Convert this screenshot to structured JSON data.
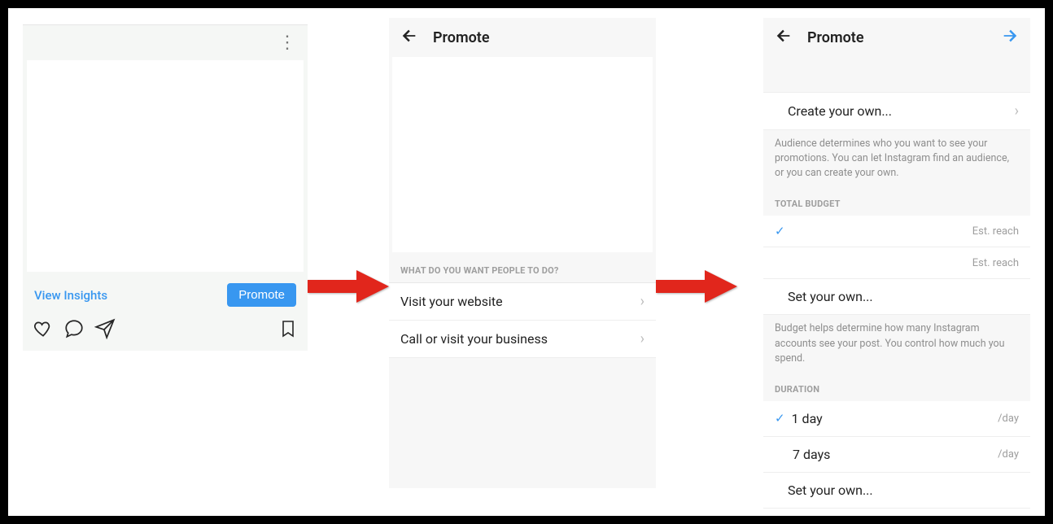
{
  "panel1": {
    "insights_label": "View Insights",
    "promote_label": "Promote"
  },
  "panel2": {
    "title": "Promote",
    "section_label": "WHAT DO YOU WANT PEOPLE TO DO?",
    "options": [
      {
        "label": "Visit your website"
      },
      {
        "label": "Call or visit your business"
      }
    ]
  },
  "panel3": {
    "title": "Promote",
    "create_own_label": "Create your own...",
    "audience_help": "Audience determines who you want to see your promotions. You can let Instagram find an audience, or you can create your own.",
    "budget_header": "TOTAL BUDGET",
    "est_reach_label": "Est. reach",
    "set_own_label": "Set your own...",
    "budget_help": "Budget helps determine how many Instagram accounts see your post. You control how much you spend.",
    "duration_header": "DURATION",
    "duration_options": [
      {
        "label": "1 day",
        "suffix": "/day",
        "selected": true
      },
      {
        "label": "7 days",
        "suffix": "/day",
        "selected": false
      }
    ],
    "duration_set_own": "Set your own..."
  }
}
